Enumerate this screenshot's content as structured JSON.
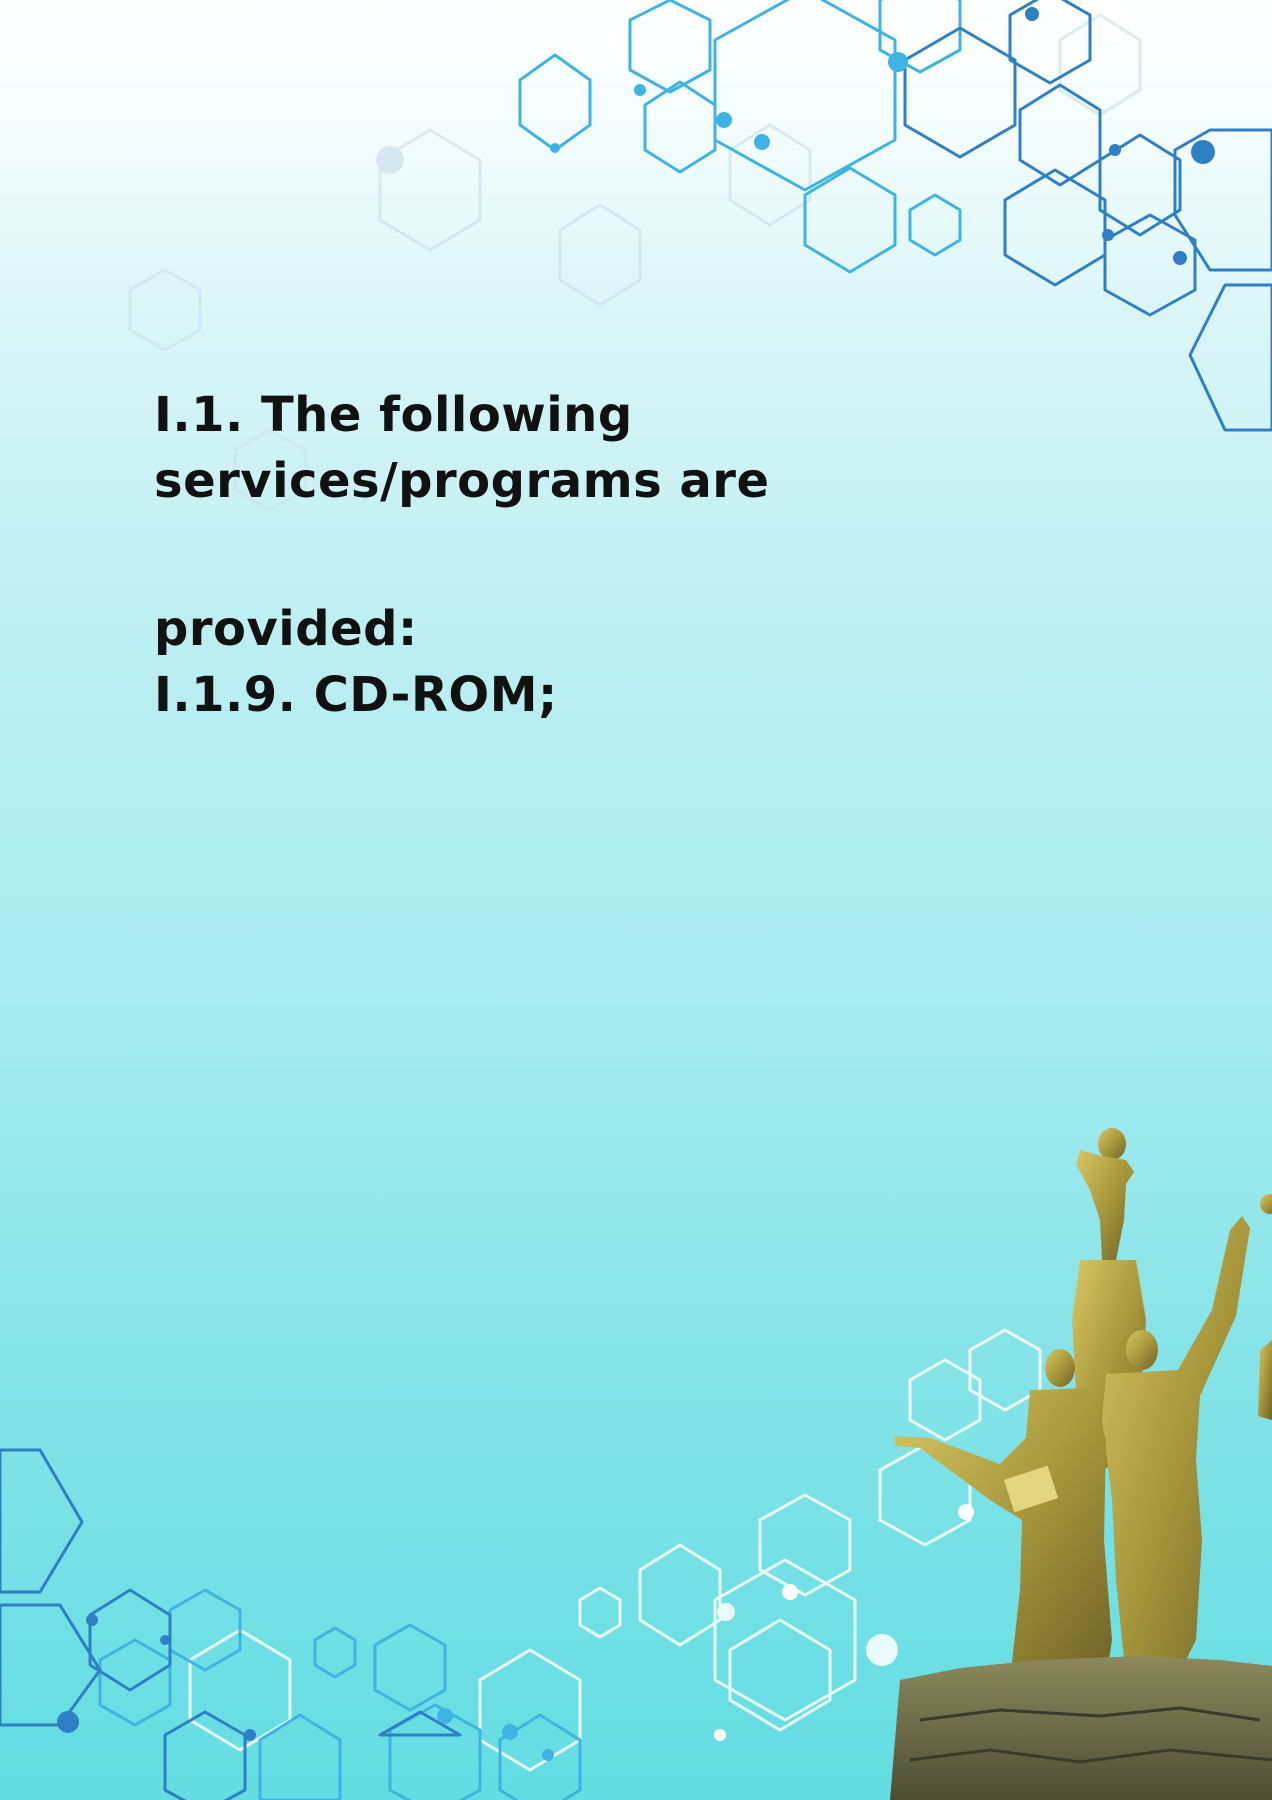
{
  "document": {
    "heading_line1": "I.1. The following",
    "heading_line2": "services/programs are",
    "heading_line3": "provided:",
    "item_line": "I.1.9. CD-ROM;"
  },
  "decor": {
    "hex_color_dark": "#2f7fc4",
    "hex_color_mid": "#3fb4e2",
    "hex_color_light": "#ffffff",
    "statue_color": "#b9a94a",
    "background_top": "#ffffff",
    "background_bottom": "#62dde2"
  }
}
